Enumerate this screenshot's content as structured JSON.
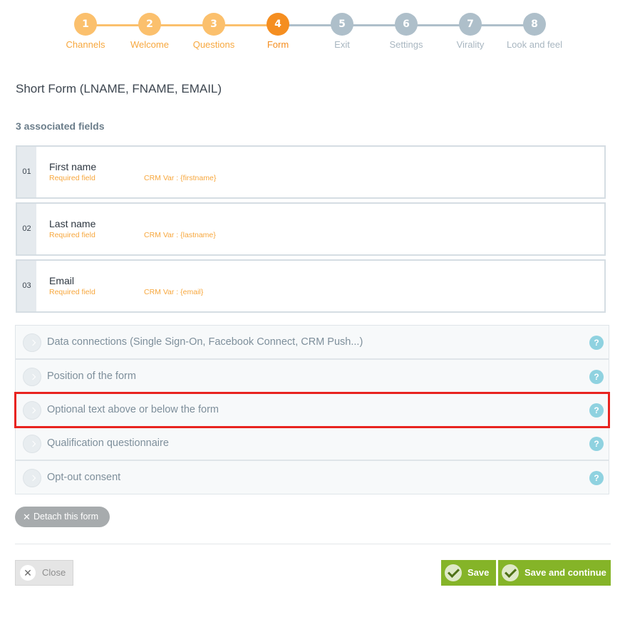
{
  "stepper": {
    "steps": [
      {
        "number": "1",
        "label": "Channels",
        "state": "done"
      },
      {
        "number": "2",
        "label": "Welcome",
        "state": "done"
      },
      {
        "number": "3",
        "label": "Questions",
        "state": "done"
      },
      {
        "number": "4",
        "label": "Form",
        "state": "current"
      },
      {
        "number": "5",
        "label": "Exit",
        "state": "todo"
      },
      {
        "number": "6",
        "label": "Settings",
        "state": "todo"
      },
      {
        "number": "7",
        "label": "Virality",
        "state": "todo"
      },
      {
        "number": "8",
        "label": "Look and feel",
        "state": "todo"
      }
    ],
    "colors": {
      "done": "#fbc06d",
      "current": "#f58e20",
      "todo": "#aebfca"
    }
  },
  "form": {
    "title": "Short Form (LNAME, FNAME, EMAIL)",
    "fields_count": "3 associated fields",
    "fields": [
      {
        "index": "01",
        "name": "First name",
        "required": "Required field",
        "crm": "CRM Var : {firstname}"
      },
      {
        "index": "02",
        "name": "Last name",
        "required": "Required field",
        "crm": "CRM Var : {lastname}"
      },
      {
        "index": "03",
        "name": "Email",
        "required": "Required field",
        "crm": "CRM Var : {email}"
      }
    ]
  },
  "accordion": {
    "items": [
      {
        "label": "Data connections (Single Sign-On, Facebook Connect, CRM Push...)",
        "help": "?"
      },
      {
        "label": "Position of the form",
        "help": "?"
      },
      {
        "label": "Optional text above or below the form",
        "help": "?",
        "highlighted": true
      },
      {
        "label": "Qualification questionnaire",
        "help": "?"
      },
      {
        "label": "Opt-out consent",
        "help": "?"
      }
    ]
  },
  "actions": {
    "detach_label": "Detach this form",
    "close_label": "Close",
    "save_label": "Save",
    "save_continue_label": "Save and continue"
  },
  "icons": {
    "detach": "close-x-icon",
    "close": "close-x-icon",
    "save": "check-icon",
    "accordion": "chevron-right-icon",
    "help": "question-mark-icon"
  },
  "colors": {
    "accent_green": "#85b428",
    "highlight_red": "#e8231f",
    "orange": "#f58e20"
  }
}
